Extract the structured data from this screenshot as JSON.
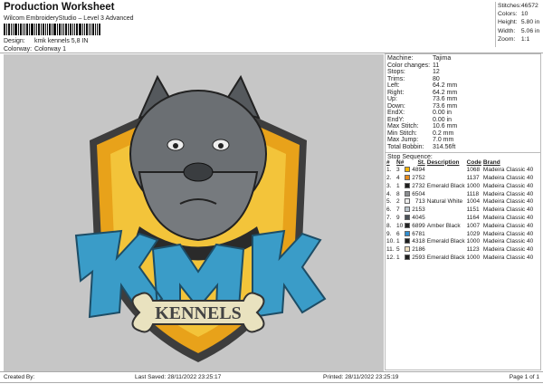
{
  "header": {
    "title": "Production Worksheet",
    "subtitle": "Wilcom EmbroideryStudio – Level 3 Advanced",
    "design_label": "Design:",
    "design_value": "kmk kennels 5,8 IN",
    "colorway_label": "Colorway:",
    "colorway_value": "Colorway 1"
  },
  "stats": [
    {
      "k": "Stitches:",
      "v": "46572"
    },
    {
      "k": "Colors:",
      "v": "10"
    },
    {
      "k": "Height:",
      "v": "5.80 in"
    },
    {
      "k": "Width:",
      "v": "5.06 in"
    },
    {
      "k": "Zoom:",
      "v": "1:1"
    }
  ],
  "machine": [
    {
      "k": "Machine:",
      "v": "Tajima"
    },
    {
      "k": "Color changes:",
      "v": "11"
    },
    {
      "k": "Stops:",
      "v": "12"
    },
    {
      "k": "Trims:",
      "v": "80"
    },
    {
      "k": "Left:",
      "v": "64.2 mm"
    },
    {
      "k": "Right:",
      "v": "64.2 mm"
    },
    {
      "k": "Up:",
      "v": "73.6 mm"
    },
    {
      "k": "Down:",
      "v": "73.6 mm"
    },
    {
      "k": "EndX:",
      "v": "0.00 in"
    },
    {
      "k": "EndY:",
      "v": "0.00 in"
    },
    {
      "k": "Max Stitch:",
      "v": "10.6 mm"
    },
    {
      "k": "Min Stitch:",
      "v": "0.2 mm"
    },
    {
      "k": "Max Jump:",
      "v": "7.0 mm"
    },
    {
      "k": "Total Bobbin:",
      "v": "314.56ft"
    }
  ],
  "stop_sequence": {
    "title": "Stop Sequence:",
    "headers": [
      "#",
      "N#",
      "St.",
      "Description",
      "Code",
      "Brand"
    ],
    "rows": [
      {
        "n": "1.",
        "nn": "3",
        "color": "#f5b400",
        "st": "4894",
        "desc": "",
        "code": "1068",
        "brand": "Madeira Classic 40"
      },
      {
        "n": "2.",
        "nn": "4",
        "color": "#e88a1a",
        "st": "2752",
        "desc": "",
        "code": "1137",
        "brand": "Madeira Classic 40"
      },
      {
        "n": "3.",
        "nn": "1",
        "color": "#1e1e1e",
        "st": "2732",
        "desc": "Emerald Black",
        "code": "1000",
        "brand": "Madeira Classic 40"
      },
      {
        "n": "4.",
        "nn": "8",
        "color": "#8a8d90",
        "st": "6504",
        "desc": "",
        "code": "1118",
        "brand": "Madeira Classic 40"
      },
      {
        "n": "5.",
        "nn": "2",
        "color": "#ececec",
        "st": "713",
        "desc": "Natural White",
        "code": "1004",
        "brand": "Madeira Classic 40"
      },
      {
        "n": "6.",
        "nn": "7",
        "color": "#b9c4cc",
        "st": "2153",
        "desc": "",
        "code": "1151",
        "brand": "Madeira Classic 40"
      },
      {
        "n": "7.",
        "nn": "9",
        "color": "#4a5058",
        "st": "4045",
        "desc": "",
        "code": "1164",
        "brand": "Madeira Classic 40"
      },
      {
        "n": "8.",
        "nn": "10",
        "color": "#222222",
        "st": "6899",
        "desc": "Amber Black",
        "code": "1007",
        "brand": "Madeira Classic 40"
      },
      {
        "n": "9.",
        "nn": "6",
        "color": "#2f8ed0",
        "st": "6781",
        "desc": "",
        "code": "1029",
        "brand": "Madeira Classic 40"
      },
      {
        "n": "10.",
        "nn": "1",
        "color": "#1e1e1e",
        "st": "4318",
        "desc": "Emerald Black",
        "code": "1000",
        "brand": "Madeira Classic 40"
      },
      {
        "n": "11.",
        "nn": "5",
        "color": "#efe0c0",
        "st": "2186",
        "desc": "",
        "code": "1123",
        "brand": "Madeira Classic 40"
      },
      {
        "n": "12.",
        "nn": "1",
        "color": "#1e1e1e",
        "st": "2593",
        "desc": "Emerald Black",
        "code": "1000",
        "brand": "Madeira Classic 40"
      }
    ]
  },
  "design_art": {
    "logo_text": "KENNELS",
    "colors": {
      "shield": "#e8a21a",
      "shield_inner": "#f3c43a",
      "dog": "#6b6f73",
      "letters": "#3a9cc8",
      "bone": "#e9e2bf"
    }
  },
  "footer": {
    "created": "Created By:",
    "saved": "Last Saved: 28/11/2022 23:25:17",
    "printed": "Printed: 28/11/2022 23:25:19",
    "page": "Page 1 of 1"
  }
}
